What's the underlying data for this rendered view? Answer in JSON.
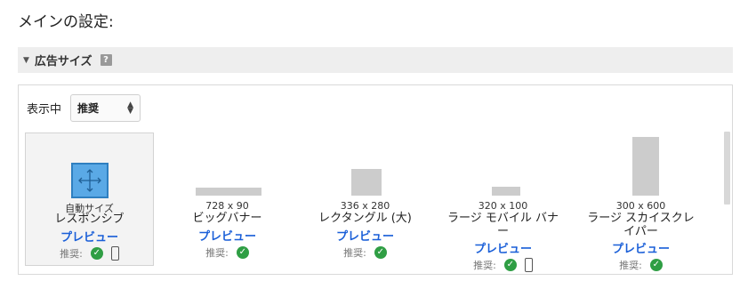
{
  "main_title": "メインの設定:",
  "section": {
    "title": "広告サイズ",
    "help_icon": "?"
  },
  "display": {
    "label": "表示中",
    "selected": "推奨"
  },
  "recommended_label": "推奨:",
  "cards": [
    {
      "dims": "",
      "sub": "自動サイズ",
      "name": "レスポンシブ",
      "preview": "プレビュー",
      "mobile": true
    },
    {
      "dims": "728 x 90",
      "name": "ビッグバナー",
      "preview": "プレビュー",
      "mobile": false
    },
    {
      "dims": "336 x 280",
      "name": "レクタングル (大)",
      "preview": "プレビュー",
      "mobile": false
    },
    {
      "dims": "320 x 100",
      "name_line1": "ラージ モバイル バナ",
      "name_line2": "ー",
      "preview": "プレビュー",
      "mobile": true
    },
    {
      "dims": "300 x 600",
      "name_line1": "ラージ スカイスクレ",
      "name_line2": "イパー",
      "preview": "プレビュー",
      "mobile": false
    }
  ],
  "colors": {
    "link": "#1a5fd8",
    "check": "#2f9e44",
    "auto_icon": "#5aa9e6"
  }
}
